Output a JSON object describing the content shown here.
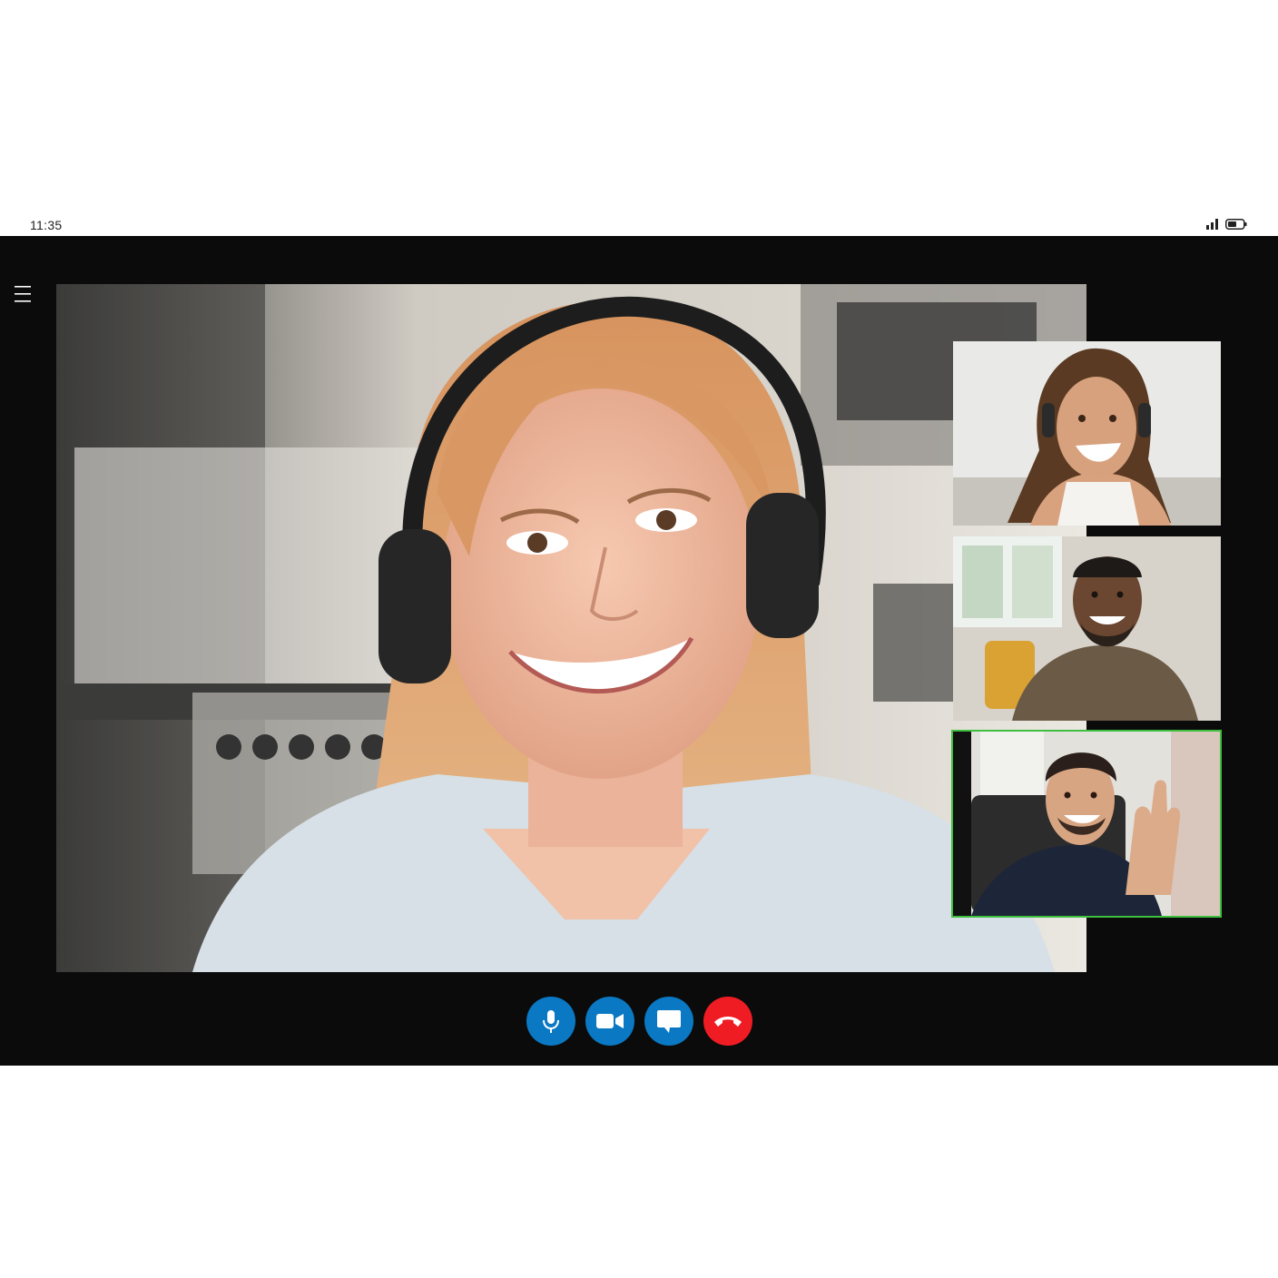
{
  "status_bar": {
    "time": "11:35",
    "signal_icon": "signal-bars-icon",
    "battery_icon": "battery-icon"
  },
  "menu": {
    "icon": "hamburger-menu-icon"
  },
  "main_video": {
    "participant_image": "woman-with-headphones-smiling-kitchen"
  },
  "participants": [
    {
      "image": "curly-haired-woman-laughing-headphones",
      "active": false
    },
    {
      "image": "bearded-man-smiling-living-room",
      "active": false
    },
    {
      "image": "man-waving-with-earphones",
      "active": true
    }
  ],
  "controls": {
    "buttons": [
      {
        "icon": "microphone-icon",
        "color": "#0a78c2"
      },
      {
        "icon": "video-camera-icon",
        "color": "#0a78c2"
      },
      {
        "icon": "chat-bubble-icon",
        "color": "#0a78c2"
      },
      {
        "icon": "end-call-icon",
        "color": "#ef1c24"
      }
    ]
  },
  "colors": {
    "frame_background": "#0b0b0b",
    "active_speaker_border": "#3fbf3f",
    "control_blue": "#0a78c2",
    "control_red": "#ef1c24"
  }
}
